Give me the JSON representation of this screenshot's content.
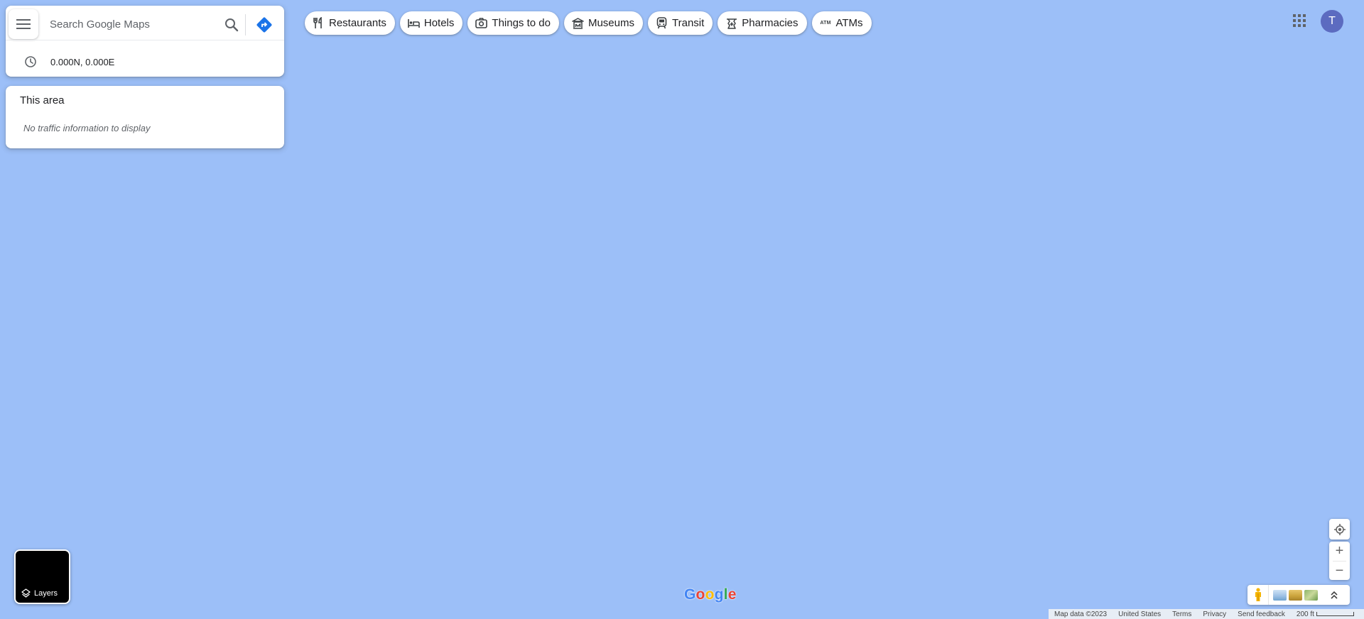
{
  "search": {
    "placeholder": "Search Google Maps",
    "recent_coords": "0.000N, 0.000E"
  },
  "traffic": {
    "title": "This area",
    "message": "No traffic information to display"
  },
  "chips": [
    {
      "label": "Restaurants",
      "icon": "restaurant-icon"
    },
    {
      "label": "Hotels",
      "icon": "hotel-icon"
    },
    {
      "label": "Things to do",
      "icon": "camera-icon"
    },
    {
      "label": "Museums",
      "icon": "museum-icon"
    },
    {
      "label": "Transit",
      "icon": "transit-icon"
    },
    {
      "label": "Pharmacies",
      "icon": "pharmacy-icon"
    },
    {
      "label": "ATMs",
      "icon": "atm-icon",
      "glyph": "ATM"
    }
  ],
  "account": {
    "initial": "T",
    "color": "#5c6bc0"
  },
  "layers": {
    "label": "Layers"
  },
  "logo": {
    "letters": [
      "G",
      "o",
      "o",
      "g",
      "l",
      "e"
    ],
    "colors": [
      "#4285f4",
      "#ea4335",
      "#fbbc05",
      "#4285f4",
      "#34a853",
      "#ea4335"
    ]
  },
  "zoom": {
    "in": "+",
    "out": "−"
  },
  "footer": {
    "map_data": "Map data ©2023",
    "region": "United States",
    "terms": "Terms",
    "privacy": "Privacy",
    "feedback": "Send feedback",
    "scale": "200 ft"
  },
  "colors": {
    "water": "#9cbff8",
    "accent": "#1a73e8"
  }
}
